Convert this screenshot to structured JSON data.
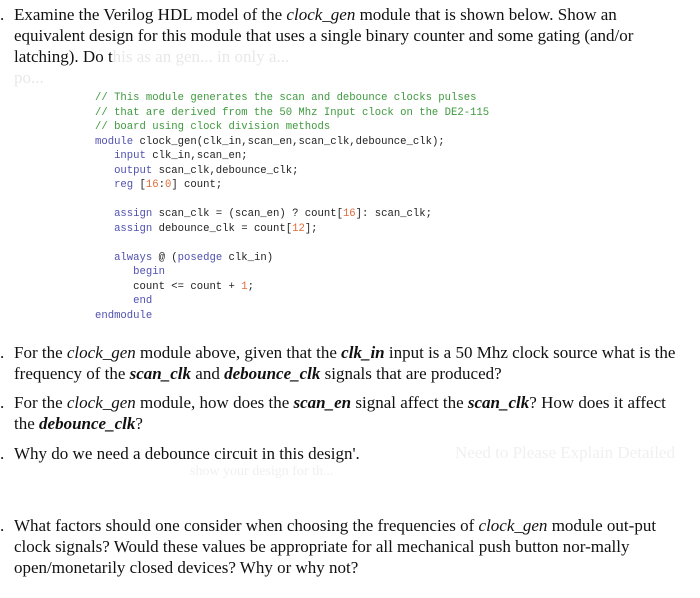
{
  "q1": {
    "bullet": ".",
    "text_a": "Examine the Verilog HDL model of the ",
    "text_it": "clock_gen",
    "text_b": " module that is shown below. Show an equivalent design for this module that uses a single binary counter and some gating (and/or latching). Do t",
    "faded_text": "his as an gen... in only a...",
    "faded_line2": "po..."
  },
  "code": {
    "comment1": "// This module generates the scan and debounce clocks pulses",
    "comment2": "// that are derived from the 50 Mhz Input clock on the DE2-115",
    "comment3": "// board using clock division methods",
    "module_kw": "module",
    "module_rest": " clock_gen(clk_in,scan_en,scan_clk,debounce_clk);",
    "input_kw": "input",
    "input_rest": " clk_in,scan_en;",
    "output_kw": "output",
    "output_rest": " scan_clk,debounce_clk;",
    "reg_kw": "reg",
    "reg_open": " [",
    "reg_msb": "16",
    "reg_colon": ":",
    "reg_lsb": "0",
    "reg_rest": "] count;",
    "assign1_kw": "assign",
    "assign1_a": " scan_clk = (scan_en) ? count[",
    "assign1_num": "16",
    "assign1_b": "]: scan_clk;",
    "assign2_kw": "assign",
    "assign2_a": " debounce_clk = count[",
    "assign2_num": "12",
    "assign2_b": "];",
    "always_kw": "always",
    "always_a": " @ (",
    "posedge_kw": "posedge",
    "always_b": " clk_in)",
    "begin_kw": "begin",
    "count_a": "count <= count + ",
    "count_num": "1",
    "count_b": ";",
    "end_kw": "end",
    "endmodule_kw": "endmodule"
  },
  "q2": {
    "bullet": ".",
    "a": "For the ",
    "it1": "clock_gen",
    "b": " module above, given that the ",
    "bi1": "clk_in",
    "c": " input is a 50 Mhz clock source what is the frequency of the ",
    "bi2": "scan_clk",
    "d": " and ",
    "bi3": "debounce_clk",
    "e": " signals that are produced?"
  },
  "q3": {
    "bullet": ".",
    "a": "For the ",
    "it1": "clock_gen",
    "b": " module, how does the ",
    "bi1": "scan_en",
    "c": " signal affect the ",
    "bi2": "scan_clk",
    "d": "? How does it affect the ",
    "bi3": "debounce_clk",
    "e": "?"
  },
  "q4": {
    "bullet": ".",
    "text": "Why do we need a debounce circuit in this design",
    "tail": "'.",
    "ghost_right": "Need to Please Explain Detailed",
    "ghost_below": "show your design for th..."
  },
  "q5": {
    "bullet": ".",
    "a": "What factors should one consider when choosing the frequencies of ",
    "it1": "clock_gen",
    "b": " module out-put clock signals? Would these values be appropriate for all mechanical push button nor-mally open/monetarily closed devices? Why or why not?"
  }
}
